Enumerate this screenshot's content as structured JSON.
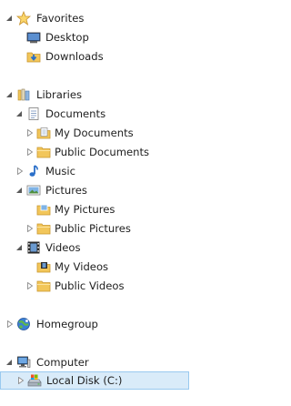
{
  "nav": {
    "favorites": {
      "label": "Favorites"
    },
    "desktop": {
      "label": "Desktop"
    },
    "downloads": {
      "label": "Downloads"
    },
    "libraries": {
      "label": "Libraries"
    },
    "documents": {
      "label": "Documents"
    },
    "my_documents": {
      "label": "My Documents"
    },
    "public_documents": {
      "label": "Public Documents"
    },
    "music": {
      "label": "Music"
    },
    "pictures": {
      "label": "Pictures"
    },
    "my_pictures": {
      "label": "My Pictures"
    },
    "public_pictures": {
      "label": "Public Pictures"
    },
    "videos": {
      "label": "Videos"
    },
    "my_videos": {
      "label": "My Videos"
    },
    "public_videos": {
      "label": "Public Videos"
    },
    "homegroup": {
      "label": "Homegroup"
    },
    "computer": {
      "label": "Computer"
    },
    "local_disk": {
      "label": "Local Disk (C:)",
      "selected": true
    }
  },
  "colors": {
    "selection_background": "#d9ebf9",
    "selection_border": "#99c9ef",
    "folder": "#f2c65a",
    "text": "#1e1e1e"
  }
}
